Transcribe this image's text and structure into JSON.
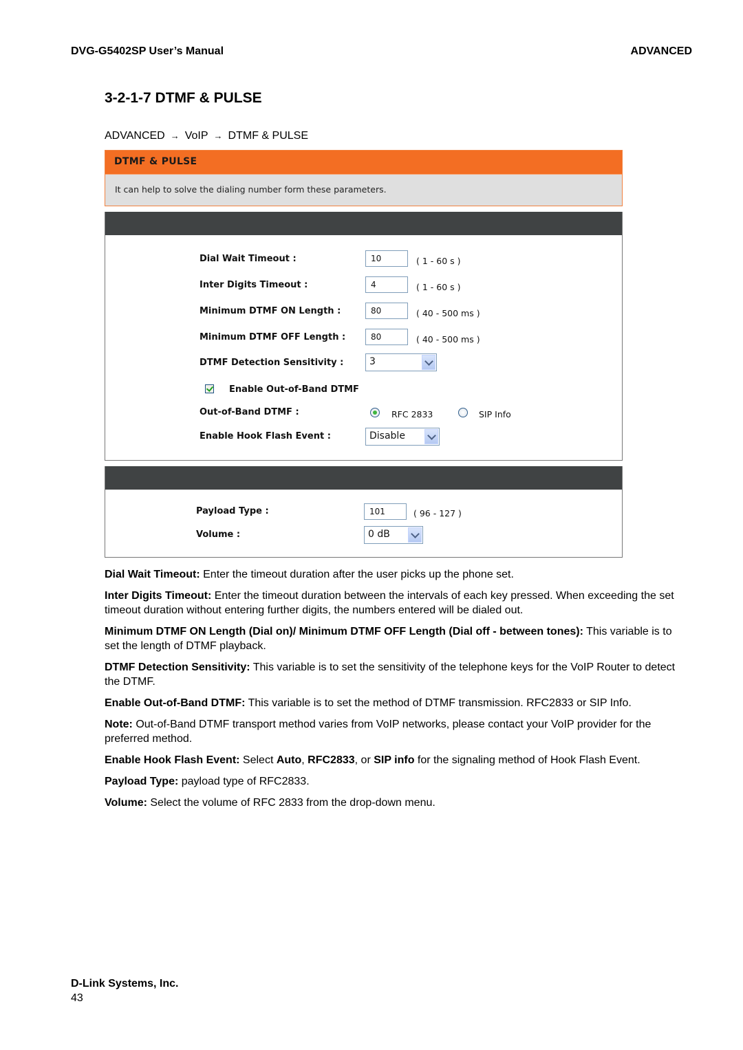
{
  "header": {
    "manual_title": "DVG-G5402SP User’s Manual",
    "chapter": "ADVANCED"
  },
  "section_title": "3-2-1-7 DTMF & PULSE",
  "breadcrumb": {
    "items": [
      "ADVANCED",
      "VoIP",
      "DTMF & PULSE"
    ],
    "separator": "→"
  },
  "ui": {
    "intro": {
      "title": "DTMF & PULSE",
      "description": "It can help to solve the dialing number form these parameters.",
      "accent_color": "#f36e23"
    },
    "dtmf_panel": {
      "dial_wait_timeout": {
        "label": "Dial Wait Timeout :",
        "value": "10",
        "hint": "( 1 - 60 s )"
      },
      "inter_digits_timeout": {
        "label": "Inter Digits Timeout :",
        "value": "4",
        "hint": "( 1 - 60 s )"
      },
      "min_dtmf_on": {
        "label": "Minimum DTMF ON Length :",
        "value": "80",
        "hint": "( 40 - 500 ms )"
      },
      "min_dtmf_off": {
        "label": "Minimum DTMF OFF Length :",
        "value": "80",
        "hint": "( 40 - 500 ms )"
      },
      "detection_sensitivity": {
        "label": "DTMF Detection Sensitivity :",
        "selected": "3"
      },
      "enable_oob": {
        "label": "Enable Out-of-Band DTMF",
        "checked": true
      },
      "oob_dtmf": {
        "label": "Out-of-Band DTMF :",
        "options": [
          "RFC 2833",
          "SIP Info"
        ],
        "selected": "RFC 2833"
      },
      "hook_flash": {
        "label": "Enable Hook Flash Event :",
        "selected": "Disable"
      }
    },
    "rfc_panel": {
      "payload_type": {
        "label": "Payload Type :",
        "value": "101",
        "hint": "( 96 - 127 )"
      },
      "volume": {
        "label": "Volume :",
        "selected": "0 dB"
      }
    }
  },
  "descriptions": [
    {
      "term": "Dial Wait Timeout:",
      "text": " Enter the timeout duration after the user picks up the phone set."
    },
    {
      "term": "Inter Digits Timeout:",
      "text": " Enter the timeout duration between the intervals of each key pressed. When exceeding the set timeout duration without entering further digits, the numbers entered will be dialed out."
    },
    {
      "term": "Minimum DTMF ON Length (Dial on)/ Minimum DTMF OFF Length (Dial off - between tones):",
      "text": " This variable is to set the length of DTMF playback."
    },
    {
      "term": "DTMF Detection Sensitivity:",
      "text": " This variable is to set the sensitivity of the telephone keys for the VoIP Router to detect the DTMF."
    },
    {
      "term": "Enable Out-of-Band DTMF:",
      "text": " This variable is to set the method of DTMF transmission. RFC2833 or SIP Info."
    },
    {
      "term": "Note:",
      "text": " Out-of-Band DTMF transport method varies from VoIP networks, please contact your VoIP provider for the preferred method."
    },
    {
      "term": "Enable Hook Flash Event:",
      "text_parts": [
        " Select ",
        "Auto",
        ", ",
        "RFC2833",
        ", or ",
        "SIP info",
        " for the signaling method of Hook Flash Event."
      ]
    },
    {
      "term": "Payload Type:",
      "text": " payload type of RFC2833."
    },
    {
      "term": "Volume:",
      "text": " Select the volume of RFC 2833 from the drop-down menu."
    }
  ],
  "footer": {
    "company": "D-Link Systems, Inc.",
    "page_number": "43"
  }
}
